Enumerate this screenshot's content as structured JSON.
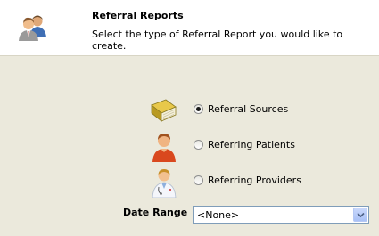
{
  "header": {
    "title": "Referral Reports",
    "subtitle": "Select the type of Referral Report you would like to create.",
    "icon": "users-icon"
  },
  "options": [
    {
      "label": "Referral Sources",
      "icon": "book-icon",
      "selected": true
    },
    {
      "label": "Referring Patients",
      "icon": "patient-icon",
      "selected": false
    },
    {
      "label": "Referring Providers",
      "icon": "doctor-icon",
      "selected": false
    }
  ],
  "date_range": {
    "label": "Date Range",
    "value": "<None>"
  },
  "colors": {
    "background": "#ebe9dc",
    "header_background": "#ffffff",
    "select_border": "#7f9db9"
  }
}
